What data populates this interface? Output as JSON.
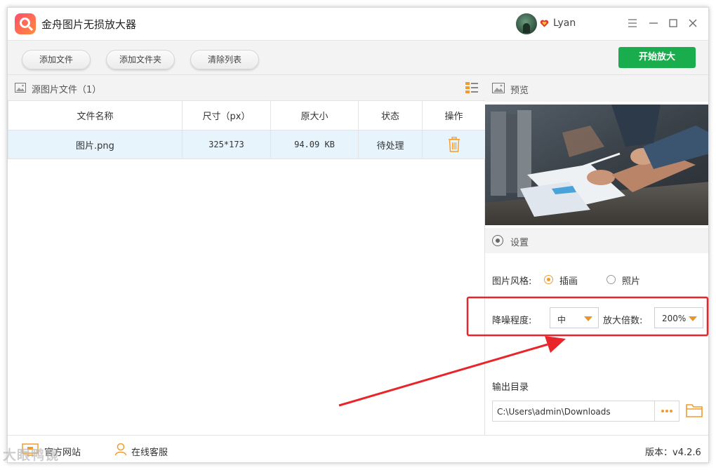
{
  "app": {
    "title": "金舟图片无损放大器",
    "username": "Lyan"
  },
  "toolbar": {
    "add_file": "添加文件",
    "add_folder": "添加文件夹",
    "clear_list": "清除列表",
    "start": "开始放大"
  },
  "file_panel": {
    "header": "源图片文件（1）",
    "columns": [
      "文件名称",
      "尺寸（px）",
      "原大小",
      "状态",
      "操作"
    ],
    "rows": [
      {
        "name": "图片.png",
        "size_px": "325*173",
        "file_size": "94.09 KB",
        "status": "待处理"
      }
    ]
  },
  "preview": {
    "header": "预览"
  },
  "settings": {
    "header": "设置",
    "style_label": "图片风格:",
    "style_options": [
      "插画",
      "照片"
    ],
    "style_selected": "插画",
    "denoise_label": "降噪程度:",
    "denoise_value": "中",
    "scale_label": "放大倍数:",
    "scale_value": "200%",
    "output_label": "输出目录",
    "output_path": "C:\\Users\\admin\\Downloads"
  },
  "statusbar": {
    "site": "官方网站",
    "support": "在线客服",
    "version": "版本：v4.2.6"
  },
  "watermark": "大眼鸭镜",
  "colors": {
    "accent": "#1aad4e",
    "orange": "#f29b2c",
    "highlight": "#e8252a"
  },
  "icons": [
    "app-logo-icon",
    "vip-heart-icon",
    "menu-icon",
    "minimize-icon",
    "maximize-icon",
    "close-icon",
    "image-icon",
    "grid-view-icon",
    "trash-icon",
    "picture-icon",
    "settings-radio-icon",
    "folder-icon",
    "website-icon",
    "support-icon"
  ]
}
